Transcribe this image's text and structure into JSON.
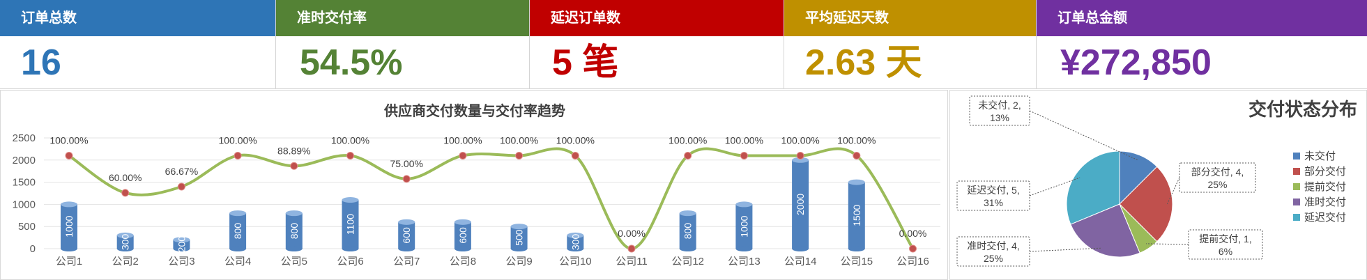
{
  "kpis": [
    {
      "label": "订单总数",
      "value": "16"
    },
    {
      "label": "准时交付率",
      "value": "54.5%"
    },
    {
      "label": "延迟订单数",
      "value": "5 笔"
    },
    {
      "label": "平均延迟天数",
      "value": "2.63 天"
    },
    {
      "label": "订单总金额",
      "value": "¥272,850"
    }
  ],
  "colors": {
    "kpi_blue": "#2e75b6",
    "kpi_green": "#548235",
    "kpi_red": "#c00000",
    "kpi_gold": "#bf9000",
    "kpi_purple": "#7030a0",
    "bar": "#4f81bd",
    "line": "#9bbb59",
    "marker": "#c0504d"
  },
  "chart_data": [
    {
      "type": "bar",
      "title": "供应商交付数量与交付率趋势",
      "categories": [
        "公司1",
        "公司2",
        "公司3",
        "公司4",
        "公司5",
        "公司6",
        "公司7",
        "公司8",
        "公司9",
        "公司10",
        "公司11",
        "公司12",
        "公司13",
        "公司14",
        "公司15",
        "公司16"
      ],
      "ylim": [
        0,
        2500
      ],
      "yticks": [
        "0",
        "500",
        "1000",
        "1500",
        "2000",
        "2500"
      ],
      "series": [
        {
          "chart": "cylinder-bar",
          "values": [
            1000,
            300,
            200,
            800,
            800,
            1100,
            600,
            600,
            500,
            300,
            0,
            800,
            1000,
            2000,
            1500,
            0
          ],
          "labels": [
            "1000",
            "300",
            "200",
            "800",
            "800",
            "1100",
            "600",
            "600",
            "500",
            "300",
            "",
            "800",
            "1000",
            "2000",
            "1500",
            ""
          ]
        },
        {
          "chart": "smooth-line",
          "values": [
            100.0,
            60.0,
            66.67,
            100.0,
            88.89,
            100.0,
            75.0,
            100.0,
            100.0,
            100.0,
            0.0,
            100.0,
            100.0,
            100.0,
            100.0,
            0.0
          ],
          "labels": [
            "100.00%",
            "60.00%",
            "66.67%",
            "100.00%",
            "88.89%",
            "100.00%",
            "75.00%",
            "100.00%",
            "100.00%",
            "100.00%",
            "0.00%",
            "100.00%",
            "100.00%",
            "100.00%",
            "100.00%",
            "0.00%"
          ]
        }
      ],
      "grid": true
    },
    {
      "type": "pie",
      "title": "交付状态分布",
      "legend": "right",
      "slices": [
        {
          "name": "未交付",
          "value": 2,
          "pct": "13%",
          "color": "#4f81bd"
        },
        {
          "name": "部分交付",
          "value": 4,
          "pct": "25%",
          "color": "#c0504d"
        },
        {
          "name": "提前交付",
          "value": 1,
          "pct": "6%",
          "color": "#9bbb59"
        },
        {
          "name": "准时交付",
          "value": 4,
          "pct": "25%",
          "color": "#8064a2"
        },
        {
          "name": "延迟交付",
          "value": 5,
          "pct": "31%",
          "color": "#4bacc6"
        }
      ]
    }
  ]
}
